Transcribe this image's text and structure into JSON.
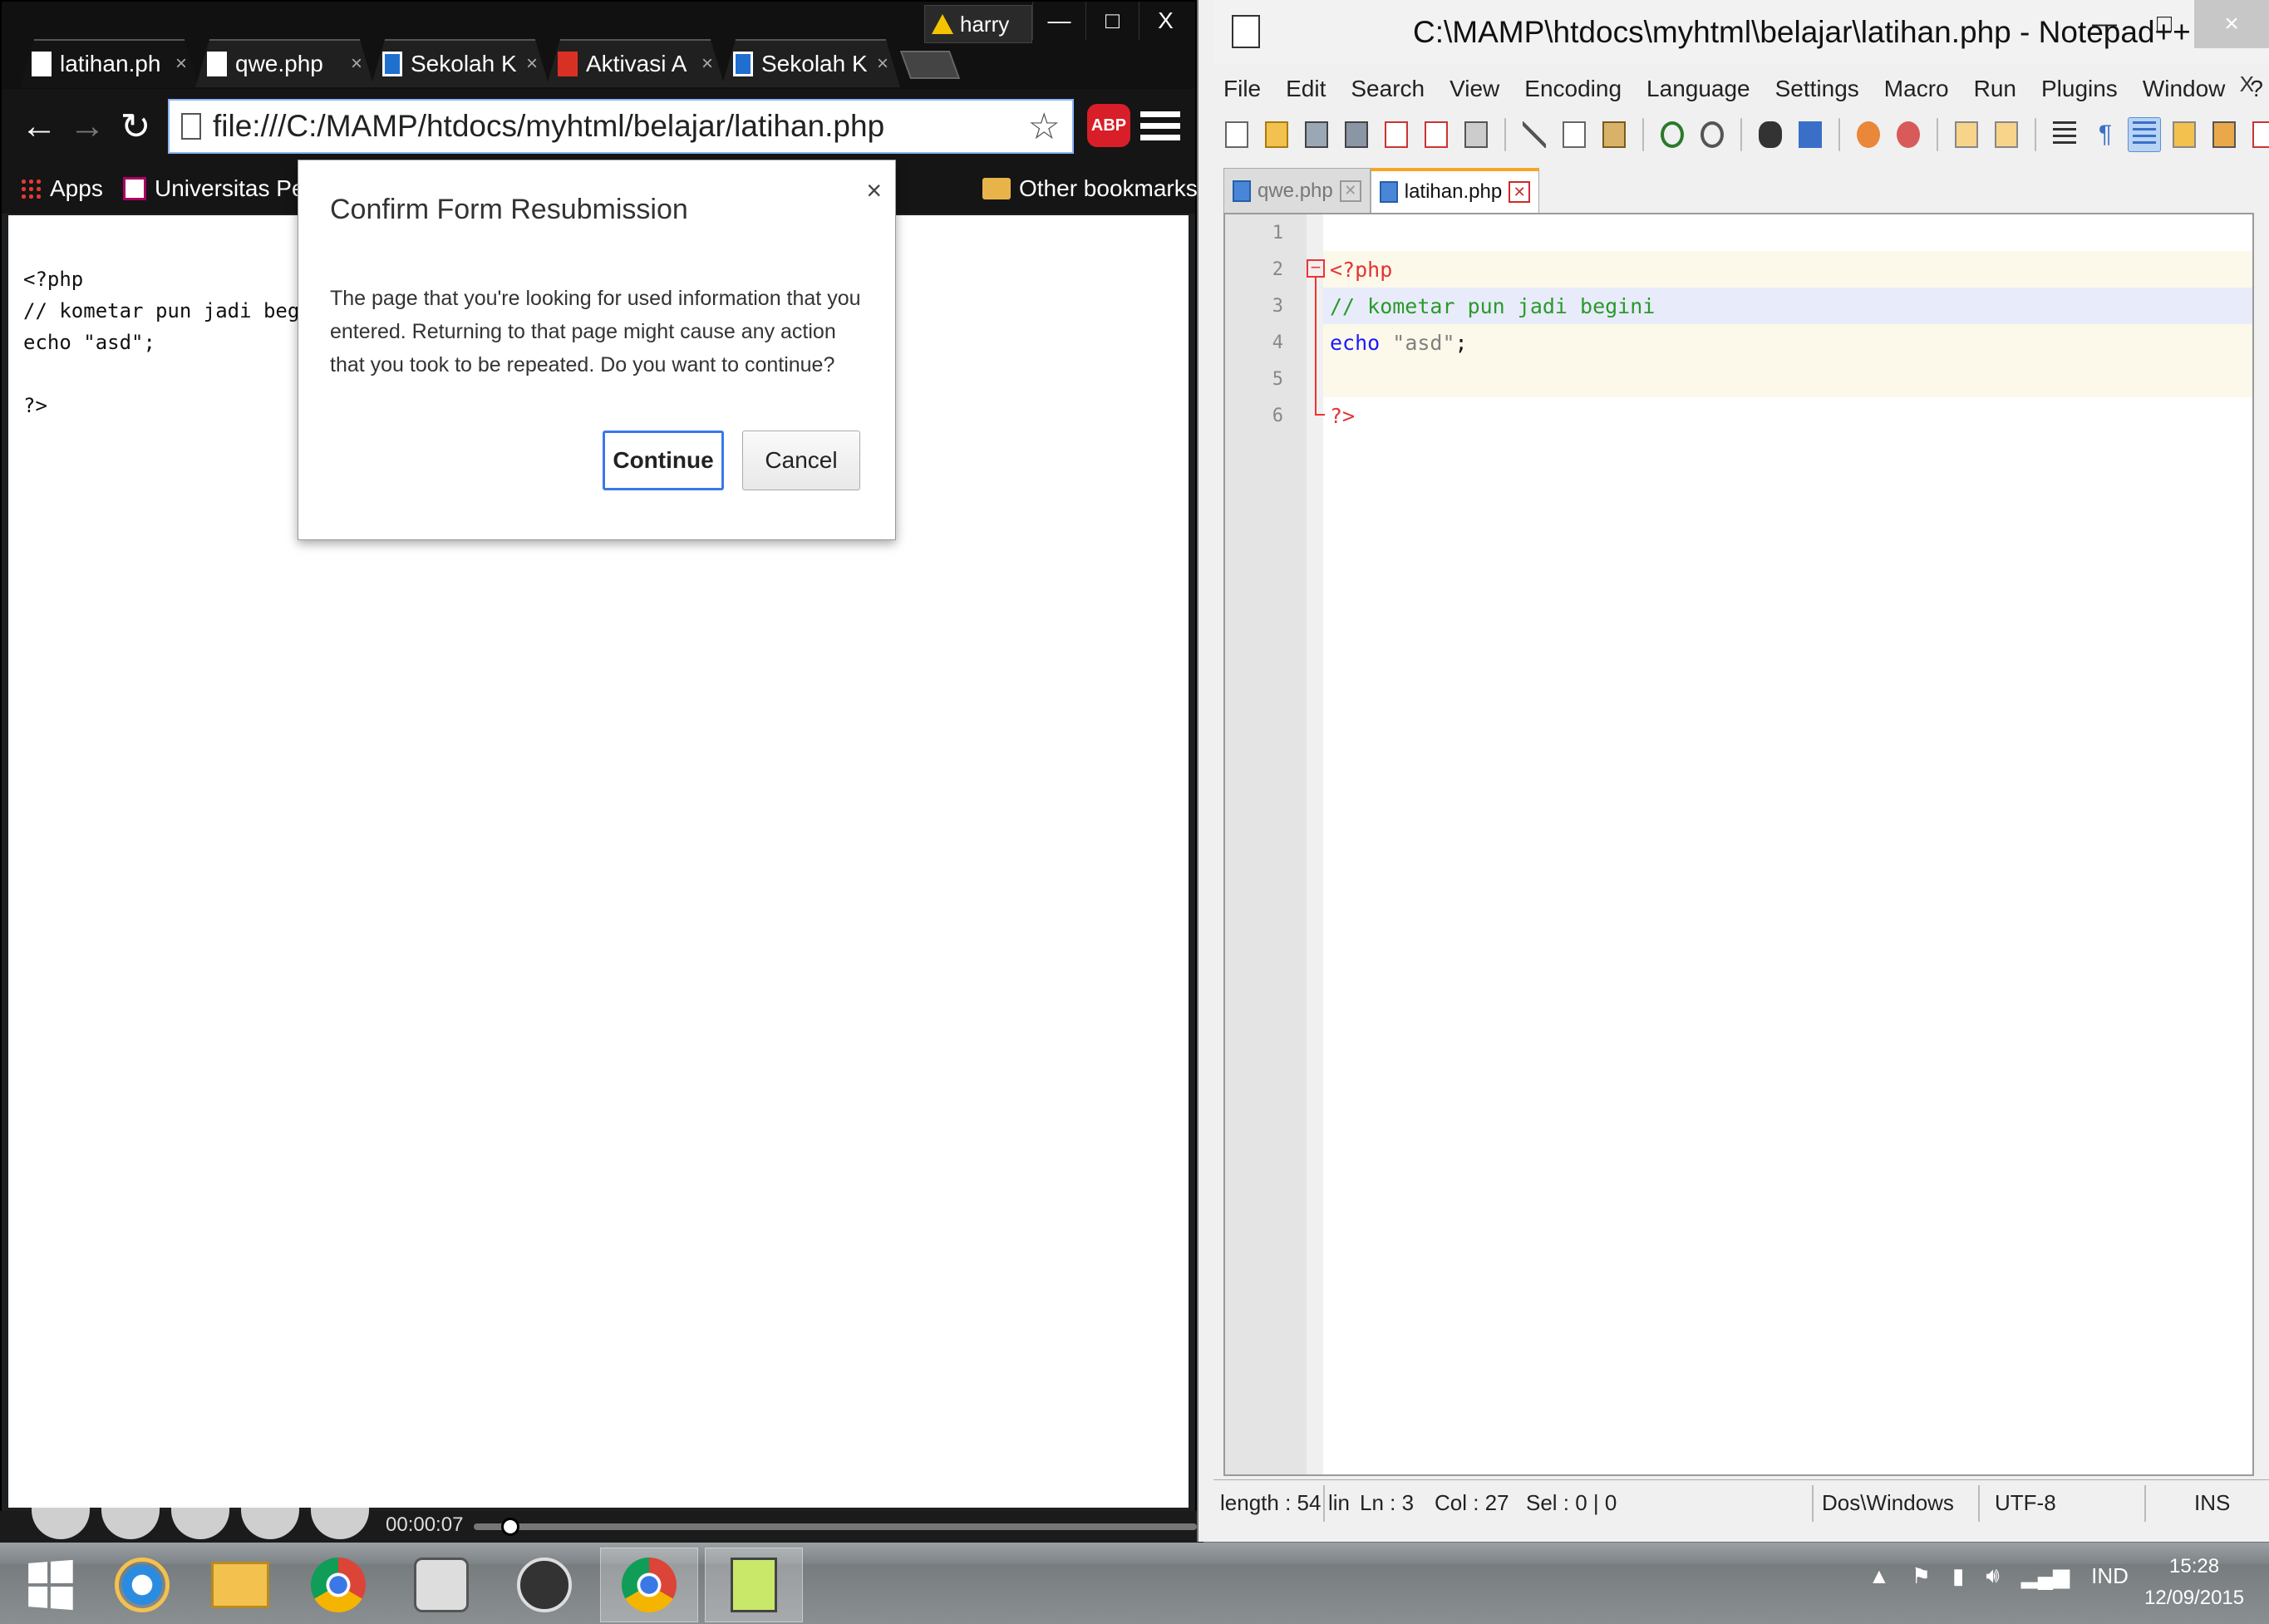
{
  "chrome": {
    "profile_name": "harry",
    "window_buttons": [
      "—",
      "□",
      "X"
    ],
    "tabs": [
      {
        "title": "latihan.ph",
        "icon": "page-icon"
      },
      {
        "title": "qwe.php",
        "icon": "page-icon"
      },
      {
        "title": "Sekolah K",
        "icon": "dock-icon"
      },
      {
        "title": "Aktivasi A",
        "icon": "gmail-icon"
      },
      {
        "title": "Sekolah K",
        "icon": "dock-icon"
      }
    ],
    "tab_close": "×",
    "url": "file:///C:/MAMP/htdocs/myhtml/belajar/latihan.php",
    "abp_label": "ABP",
    "bookmarks": {
      "apps": "Apps",
      "item1": "Universitas Pelit",
      "other": "Other bookmarks"
    },
    "page_lines": [
      "<?php",
      "// kometar pun jadi beg",
      "echo \"asd\";",
      "",
      "?>"
    ]
  },
  "dialog": {
    "title": "Confirm Form Resubmission",
    "close": "×",
    "body": "The page that you're looking for used information that you entered. Returning to that page might cause any action that you took to be repeated. Do you want to continue?",
    "continue_label": "Continue",
    "cancel_label": "Cancel"
  },
  "media": {
    "time": "00:00:07",
    "progress": 0.05
  },
  "npp": {
    "title": "C:\\MAMP\\htdocs\\myhtml\\belajar\\latihan.php - Notepad++",
    "window_buttons": [
      "—",
      "□",
      "×"
    ],
    "menu": [
      "File",
      "Edit",
      "Search",
      "View",
      "Encoding",
      "Language",
      "Settings",
      "Macro",
      "Run",
      "Plugins",
      "Window",
      "?"
    ],
    "menu_close": "X",
    "tabs": [
      {
        "title": "qwe.php",
        "state": "inactive"
      },
      {
        "title": "latihan.php",
        "state": "active"
      }
    ],
    "line_numbers": [
      "1",
      "2",
      "3",
      "4",
      "5",
      "6"
    ],
    "code": {
      "line2": "<?php",
      "line3": "// kometar pun jadi begini",
      "line4_keyword": "echo",
      "line4_string": "\"asd\"",
      "line4_end": ";",
      "line6": "?>"
    },
    "status": {
      "length": "length : 54",
      "lines": "lin",
      "ln": "Ln : 3",
      "col": "Col : 27",
      "sel": "Sel : 0 | 0",
      "eol": "Dos\\Windows",
      "encoding": "UTF-8",
      "mode": "INS"
    },
    "colors": {
      "php_tag": "#e33333",
      "comment": "#2a9a2a",
      "keyword": "#1a1aff",
      "string": "#808080"
    }
  },
  "taskbar": {
    "apps": [
      "windows-start",
      "internet-explorer",
      "file-explorer",
      "chrome",
      "media-player",
      "mamp",
      "chrome-active",
      "notepad-plus-plus"
    ],
    "language": "IND",
    "time": "15:28",
    "date": "12/09/2015"
  }
}
